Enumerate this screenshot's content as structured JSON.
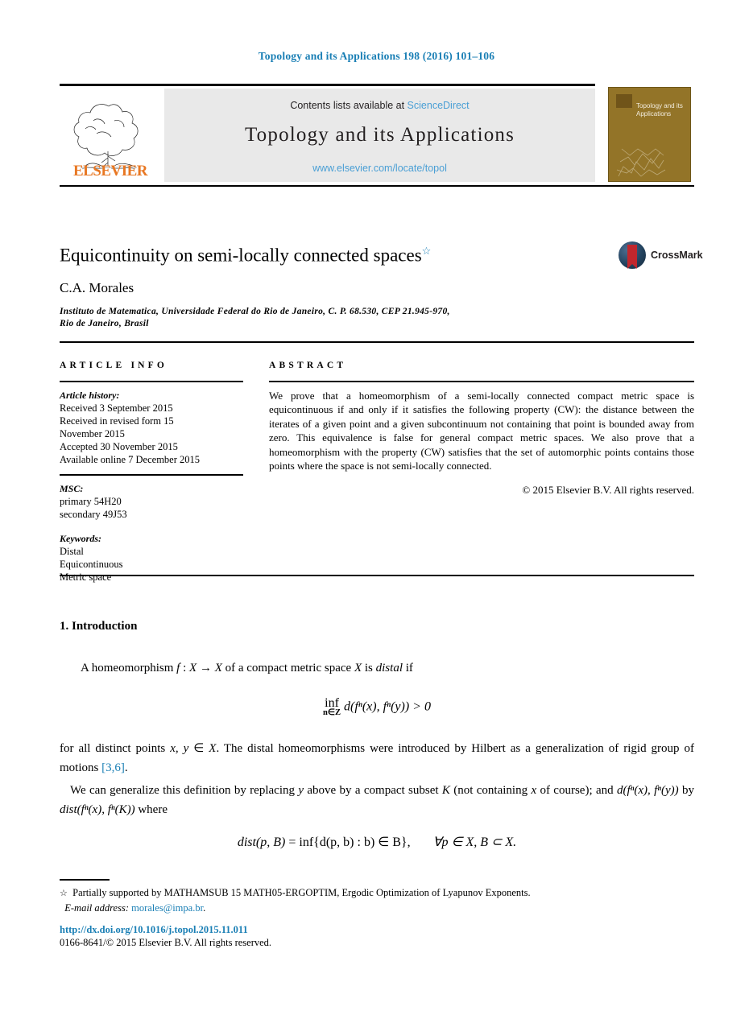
{
  "running_head": "Topology and its Applications 198 (2016) 101–106",
  "masthead": {
    "publisher_name": "ELSEVIER",
    "contents_prefix": "Contents lists available at ",
    "contents_link": "ScienceDirect",
    "journal_title": "Topology and its Applications",
    "journal_url": "www.elsevier.com/locate/topol",
    "cover_title": "Topology and its Applications"
  },
  "article": {
    "title": "Equicontinuity on semi-locally connected spaces",
    "title_marker": "☆",
    "author": "C.A. Morales",
    "affiliation_line1": "Instituto de Matematica, Universidade Federal do Rio de Janeiro, C. P. 68.530, CEP 21.945-970,",
    "affiliation_line2": "Rio de Janeiro, Brasil"
  },
  "crossmark": {
    "label": "CrossMark"
  },
  "info": {
    "heading": "ARTICLE INFO",
    "history_label": "Article history:",
    "history_lines": [
      "Received 3 September 2015",
      "Received in revised form 15",
      "November 2015",
      "Accepted 30 November 2015",
      "Available online 7 December 2015"
    ],
    "msc_label": "MSC:",
    "msc_lines": [
      "primary 54H20",
      "secondary 49J53"
    ],
    "keywords_label": "Keywords:",
    "keywords": [
      "Distal",
      "Equicontinuous",
      "Metric space"
    ]
  },
  "abstract": {
    "heading": "ABSTRACT",
    "body": "We prove that a homeomorphism of a semi-locally connected compact metric space is equicontinuous if and only if it satisfies the following property (CW): the distance between the iterates of a given point and a given subcontinuum not containing that point is bounded away from zero. This equivalence is false for general compact metric spaces. We also prove that a homeomorphism with the property (CW) satisfies that the set of automorphic points contains those points where the space is not semi-locally connected.",
    "copyright": "© 2015 Elsevier B.V. All rights reserved."
  },
  "body": {
    "section_title": "1. Introduction",
    "para1_a": "A homeomorphism ",
    "para1_f": "f",
    "para1_b": " : ",
    "para1_x1": "X",
    "para1_arrow": " → ",
    "para1_x2": "X",
    "para1_c": " of a compact metric space ",
    "para1_x3": "X",
    "para1_d": " is ",
    "para1_distal": "distal",
    "para1_e": " if",
    "equation1": {
      "inf": "inf",
      "inf_sub": "n∈Z",
      "expr_d": "d",
      "expr": "(fⁿ(x), fⁿ(y)) > 0"
    },
    "para2_a": "for all distinct points ",
    "para2_xy": "x, y",
    "para2_b": " ∈ ",
    "para2_x": "X",
    "para2_c": ". The distal homeomorphisms were introduced by Hilbert as a generalization of rigid group of motions ",
    "para2_cite": "[3,6]",
    "para2_d": ".",
    "para3_a": "We can generalize this definition by replacing ",
    "para3_y": "y",
    "para3_b": " above by a compact subset ",
    "para3_k": "K",
    "para3_c": " (not containing ",
    "para3_x": "x",
    "para3_d": " of course); and ",
    "para3_e": "d(fⁿ(x), fⁿ(y))",
    "para3_f": " by ",
    "para3_g": "dist(fⁿ(x), fⁿ(K))",
    "para3_h": " where",
    "equation2": {
      "lhs": "dist(p, B)",
      "eq": " = ",
      "rhs": "inf{d(p, b) : b) ∈ B},",
      "quantifier": "∀p ∈ X, B ⊂ X."
    }
  },
  "footnotes": {
    "star": "☆",
    "funding": "Partially supported by MATHAMSUB 15 MATH05-ERGOPTIM, Ergodic Optimization of Lyapunov Exponents.",
    "email_label": "E-mail address:",
    "email": "morales@impa.br",
    "email_period": ".",
    "doi": "http://dx.doi.org/10.1016/j.topol.2015.11.011",
    "issn": "0166-8641/© 2015 Elsevier B.V. All rights reserved."
  }
}
